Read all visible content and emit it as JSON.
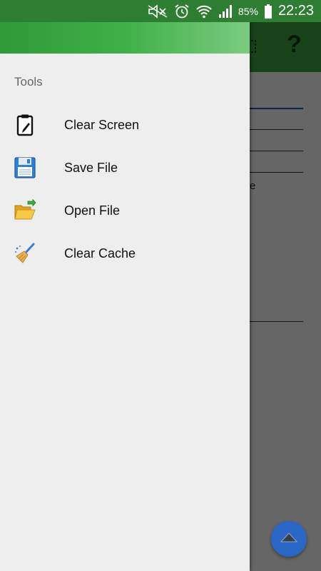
{
  "status_bar": {
    "battery": "85%",
    "time": "22:23",
    "icons": [
      "mute-icon",
      "alarm-icon",
      "wifi-icon",
      "signal-icon",
      "battery-icon"
    ]
  },
  "background_app": {
    "toolbar_icons": [
      "grid-icon",
      "help-icon"
    ],
    "help_symbol": "?",
    "partial_text": "e"
  },
  "drawer": {
    "section_title": "Tools",
    "items": [
      {
        "label": "Clear Screen",
        "icon": "clipboard-icon"
      },
      {
        "label": "Save File",
        "icon": "floppy-disk-icon"
      },
      {
        "label": "Open File",
        "icon": "open-folder-icon"
      },
      {
        "label": "Clear Cache",
        "icon": "broom-icon"
      }
    ]
  },
  "fab": {
    "icon": "arrow-up-icon"
  },
  "colors": {
    "status_bar": "#2e7d32",
    "toolbar": "#3aa642",
    "drawer_bg": "#eeeeee",
    "fab": "#2a66c6"
  }
}
